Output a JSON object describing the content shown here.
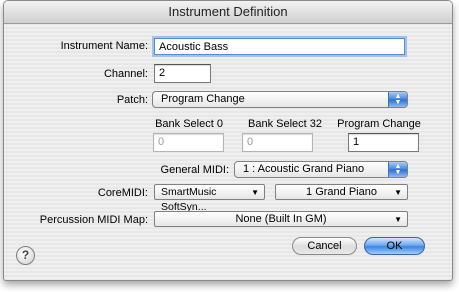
{
  "window": {
    "title": "Instrument Definition"
  },
  "form": {
    "instrument_name_label": "Instrument Name:",
    "instrument_name_value": "Acoustic Bass",
    "channel_label": "Channel:",
    "channel_value": "2",
    "patch_label": "Patch:",
    "patch_value": "Program Change",
    "bank_select_0_label": "Bank Select 0",
    "bank_select_0_value": "0",
    "bank_select_32_label": "Bank Select 32",
    "bank_select_32_value": "0",
    "program_change_label": "Program Change",
    "program_change_value": "1",
    "general_midi_label": "General MIDI:",
    "general_midi_value": "1 : Acoustic Grand Piano",
    "coremidi_label": "CoreMIDI:",
    "coremidi_device_value": "SmartMusic SoftSyn...",
    "coremidi_instrument_value": "1 Grand Piano",
    "percussion_map_label": "Percussion MIDI Map:",
    "percussion_map_value": "None (Built In GM)"
  },
  "buttons": {
    "help_label": "?",
    "cancel_label": "Cancel",
    "ok_label": "OK"
  },
  "icons": {
    "stepper": "up-down-arrows-icon",
    "dropdown": "chevron-down-icon"
  },
  "colors": {
    "accent": "#3b86e6",
    "focus_ring": "#9ec1ee"
  }
}
